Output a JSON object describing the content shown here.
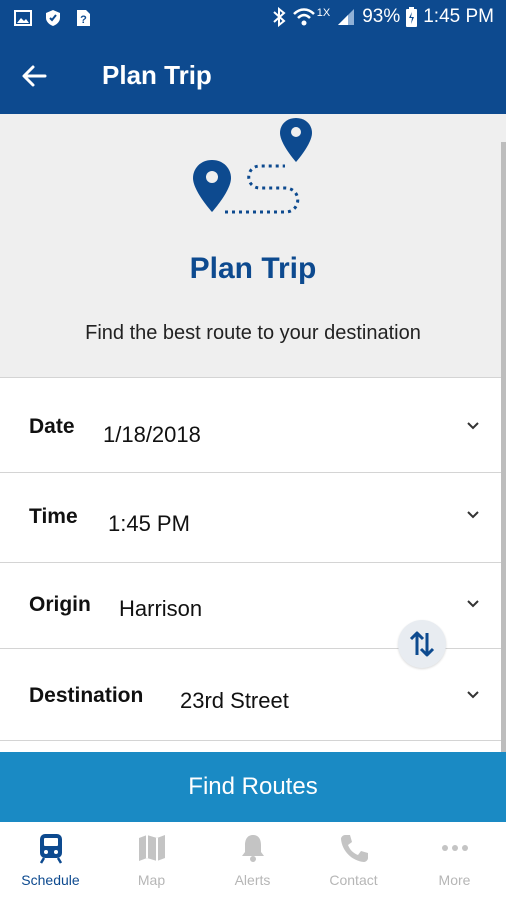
{
  "status_bar": {
    "network": "1X",
    "battery": "93%",
    "time": "1:45 PM"
  },
  "app_bar": {
    "title": "Plan Trip",
    "back_icon": "arrow-left-icon"
  },
  "hero": {
    "title": "Plan Trip",
    "subtitle": "Find the best route to your destination",
    "accent_color": "#0d4a8f"
  },
  "form": {
    "date": {
      "label": "Date",
      "value": "1/18/2018"
    },
    "time": {
      "label": "Time",
      "value": "1:45 PM"
    },
    "origin": {
      "label": "Origin",
      "value": "Harrison"
    },
    "destination": {
      "label": "Destination",
      "value": "23rd Street"
    }
  },
  "find_button": {
    "label": "Find Routes",
    "color": "#1a8ac4"
  },
  "bottom_nav": {
    "items": [
      {
        "label": "Schedule",
        "icon": "train-icon",
        "active": true
      },
      {
        "label": "Map",
        "icon": "map-icon",
        "active": false
      },
      {
        "label": "Alerts",
        "icon": "bell-icon",
        "active": false
      },
      {
        "label": "Contact",
        "icon": "phone-icon",
        "active": false
      },
      {
        "label": "More",
        "icon": "more-dots-icon",
        "active": false
      }
    ]
  }
}
